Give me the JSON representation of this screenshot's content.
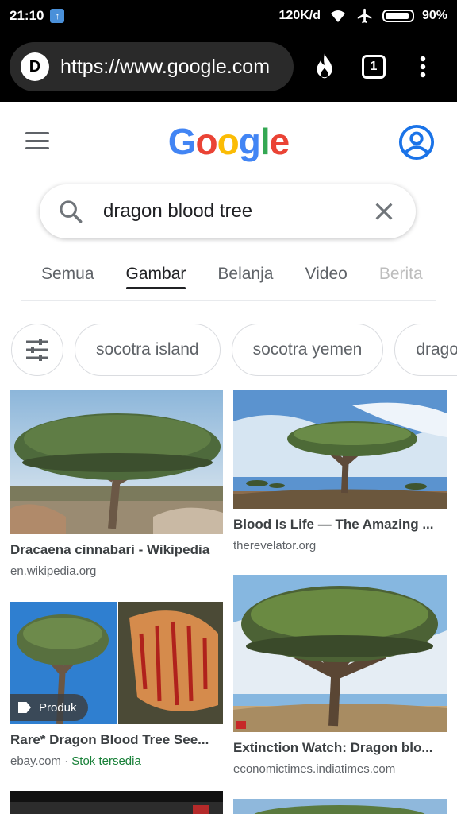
{
  "status_bar": {
    "time": "21:10",
    "speed": "120K/d",
    "battery": "90%",
    "battery_level": 0.9
  },
  "browser": {
    "url": "https://www.google.com",
    "favicon_letter": "D",
    "tab_count": "1"
  },
  "google": {
    "logo": "Google"
  },
  "search": {
    "query": "dragon blood tree"
  },
  "tabs": [
    {
      "label": "Semua"
    },
    {
      "label": "Gambar",
      "active": true
    },
    {
      "label": "Belanja"
    },
    {
      "label": "Video"
    },
    {
      "label": "Berita"
    }
  ],
  "chips": [
    "socotra island",
    "socotra yemen",
    "dragon"
  ],
  "results": [
    {
      "title": "Dracaena cinnabari - Wikipedia",
      "source": "en.wikipedia.org"
    },
    {
      "title": "Blood Is Life — The Amazing ...",
      "source": "therevelator.org"
    },
    {
      "title": "Rare* Dragon Blood Tree See...",
      "source": "ebay.com",
      "stock": "Stok tersedia",
      "badge": "Produk"
    },
    {
      "title": "Extinction Watch: Dragon blo...",
      "source": "economictimes.indiatimes.com"
    }
  ],
  "colors": {
    "logo_blue": "#4285F4",
    "logo_red": "#EA4335",
    "logo_yellow": "#FBBC05",
    "logo_green": "#34A853",
    "account_blue": "#1a73e8",
    "stock_green": "#188038"
  }
}
